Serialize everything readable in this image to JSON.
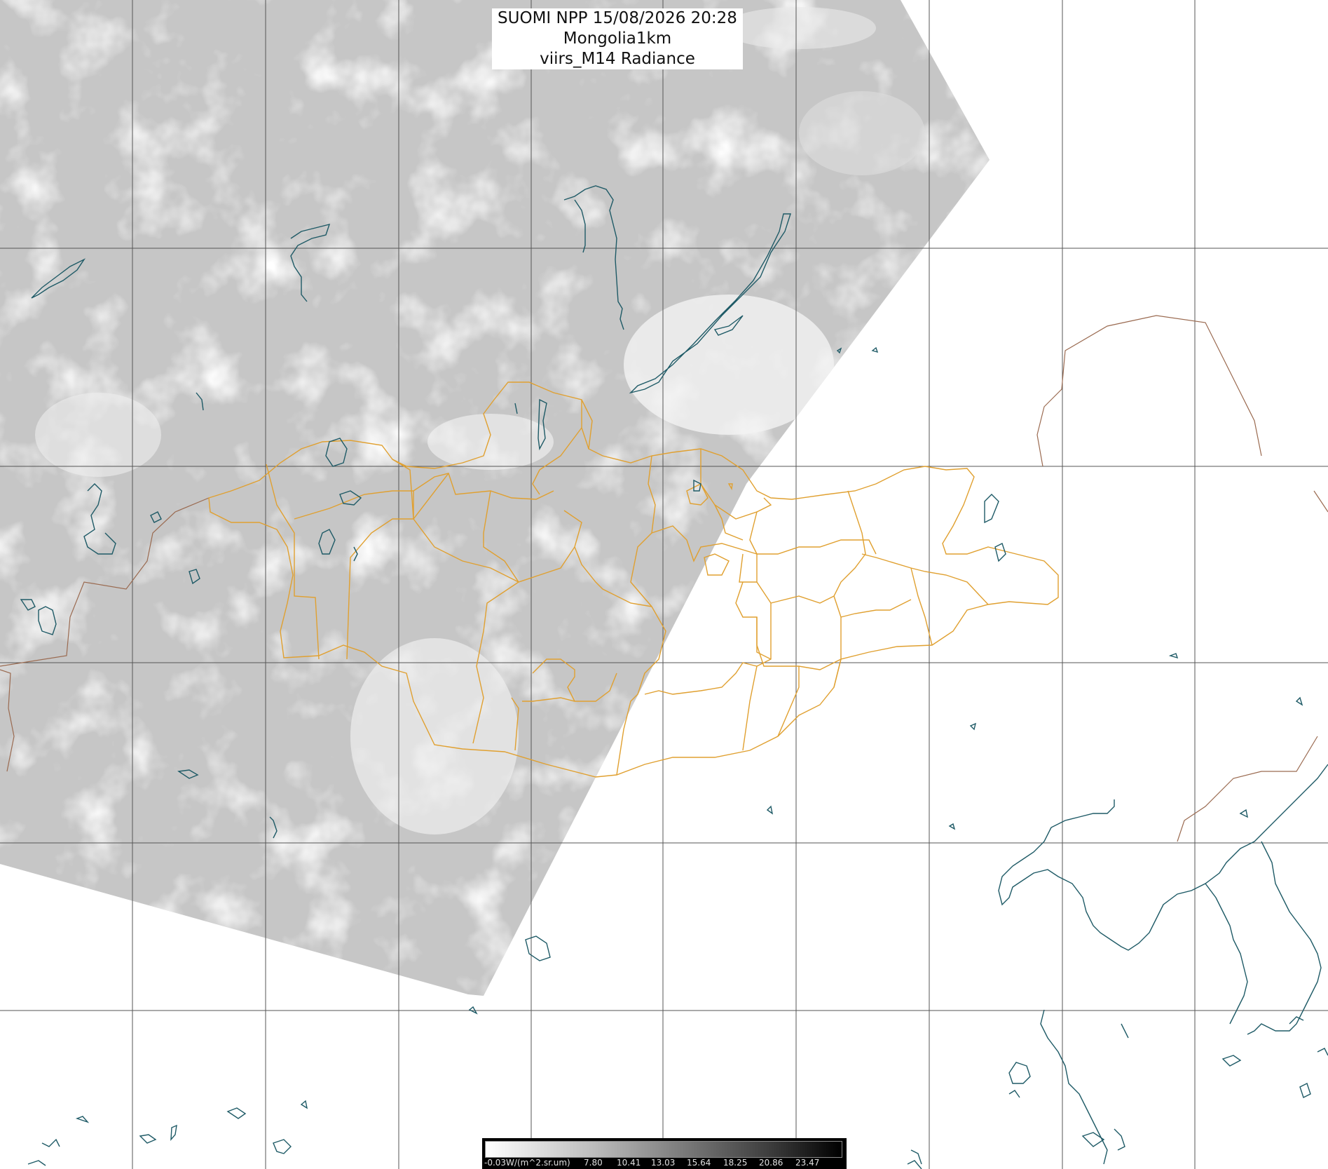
{
  "title": {
    "line1": "SUOMI NPP 15/08/2026 20:28 Mongolia1km",
    "line2": "viirs_M14 Radiance"
  },
  "colorbar": {
    "unit_label": "-0.03W/(m^2.sr.um)",
    "ticks": [
      "7.80",
      "10.41",
      "13.03",
      "15.64",
      "18.25",
      "20.86",
      "23.47"
    ]
  },
  "colors": {
    "background": "#ffffff",
    "swath": "#c4c4c4",
    "grid": "#555555",
    "province_border": "#e0a030",
    "country_border": "#9a6a50",
    "coastline": "#1e5a66"
  },
  "icons": [
    "map-grid",
    "province-boundaries",
    "coastline"
  ]
}
